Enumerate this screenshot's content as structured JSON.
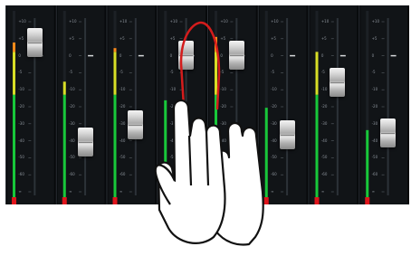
{
  "mixer": {
    "channel_count": 8,
    "colors": {
      "panel": "#07090b",
      "strip": "#111417",
      "meter_low": "#18c83a",
      "meter_mid": "#d8de26",
      "meter_high": "#ff8b1a",
      "meter_top": "#3b7fd9",
      "clip": "#e0141b",
      "gesture_loop": "#d41c1c"
    },
    "scale_labels": [
      "+10",
      "+5",
      "0",
      "-5",
      "-10",
      "-20",
      "-30",
      "-40",
      "-50",
      "-60",
      "∞"
    ],
    "channels": [
      {
        "fader_level": 0.86,
        "meter_level": 0.83
      },
      {
        "fader_level": 0.3,
        "meter_level": 0.62
      },
      {
        "fader_level": 0.4,
        "meter_level": 0.8
      },
      {
        "fader_level": 0.79,
        "meter_level": 0.52
      },
      {
        "fader_level": 0.79,
        "meter_level": 0.86
      },
      {
        "fader_level": 0.34,
        "meter_level": 0.48
      },
      {
        "fader_level": 0.64,
        "meter_level": 0.78
      },
      {
        "fader_level": 0.35,
        "meter_level": 0.36
      }
    ]
  },
  "overlay": {
    "hand_icon": "pinch-gesture-hand-icon",
    "gesture": "swipe-up-loop"
  }
}
